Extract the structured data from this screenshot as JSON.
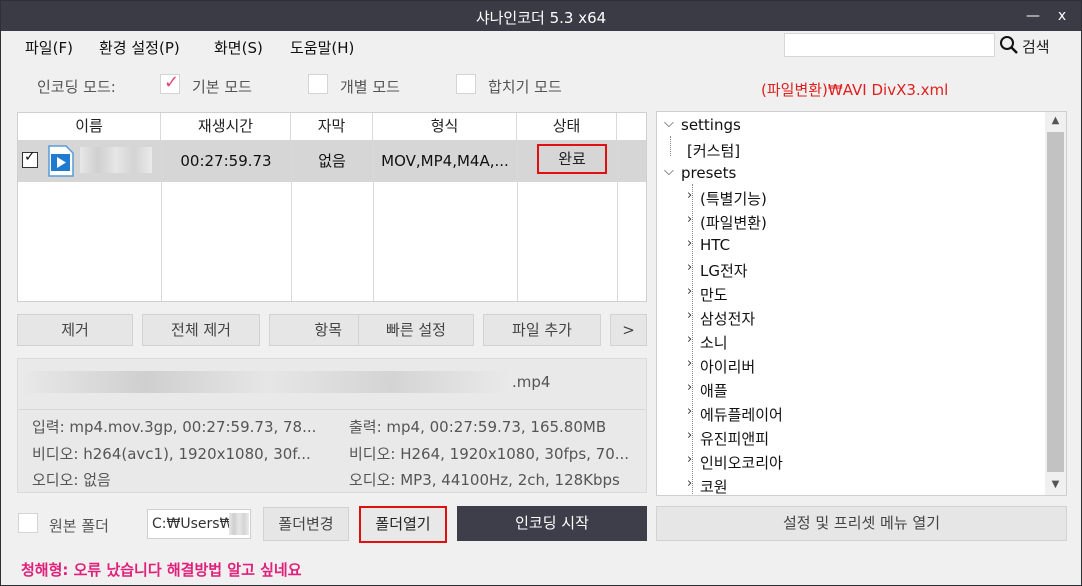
{
  "window": {
    "title": "샤나인코더  5.3  x64",
    "minimize": "—",
    "close": "x"
  },
  "menu": [
    "파일(F)",
    "환경 설정(P)",
    "화면(S)",
    "도움말(H)"
  ],
  "search": {
    "value": "",
    "label": "검색"
  },
  "modes": {
    "label": "인코딩 모드:",
    "options": [
      {
        "label": "기본 모드",
        "checked": true
      },
      {
        "label": "개별 모드",
        "checked": false
      },
      {
        "label": "합치기 모드",
        "checked": false
      }
    ]
  },
  "preset_path": "(파일변환)₩AVI DivX3.xml",
  "file_list": {
    "headers": [
      "이름",
      "재생시간",
      "자막",
      "형식",
      "상태"
    ],
    "rows": [
      {
        "checked": true,
        "name": "",
        "duration": "00:27:59.73",
        "subtitle": "없음",
        "format": "MOV,MP4,M4A,...",
        "status": "완료"
      }
    ]
  },
  "actions": [
    "제거",
    "전체 제거",
    "항목",
    "빠른 설정",
    "파일 추가",
    ">"
  ],
  "info": {
    "filename": ".mp4",
    "input": "입력: mp4.mov.3gp, 00:27:59.73, 78...",
    "input_video": "비디오: h264(avc1), 1920x1080, 30f...",
    "input_audio": "오디오: 없음",
    "output": "출력: mp4, 00:27:59.73, 165.80MB",
    "output_video": "비디오: H264, 1920x1080, 30fps, 70...",
    "output_audio": "오디오: MP3, 44100Hz, 2ch, 128Kbps"
  },
  "tree": {
    "items": [
      "settings",
      "[커스텀]",
      "presets",
      "(특별기능)",
      "(파일변환)",
      "HTC",
      "LG전자",
      "만도",
      "삼성전자",
      "소니",
      "아이리버",
      "애플",
      "에듀플레이어",
      "유진피앤피",
      "인비오코리아",
      "코원"
    ]
  },
  "bottom": {
    "original_folder_label": "원본 폴더",
    "original_folder_checked": false,
    "path": "C:₩Users₩",
    "change_folder": "폴더변경",
    "open_folder": "폴더열기",
    "start_encoding": "인코딩 시작",
    "settings_menu": "설정 및 프리셋 메뉴 열기"
  },
  "message": "청해형: 오류 났습니다 해결방법 알고 싶네요",
  "colors": {
    "accent_red": "#e01010",
    "message_pink": "#e0207a",
    "titlebar": "#3b3b46"
  }
}
